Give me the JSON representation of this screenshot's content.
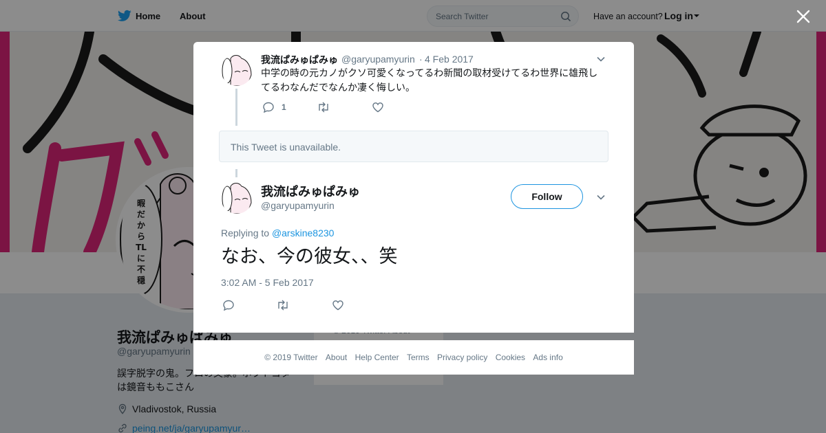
{
  "nav": {
    "home_label": "Home",
    "about_label": "About",
    "search_placeholder": "Search Twitter",
    "have_account": "Have an account?",
    "login_label": "Log in"
  },
  "profile": {
    "name": "我流ぱみゅぱみゅ",
    "handle": "@garyupamyurin",
    "bio": "誤字脱字の鬼。フロの文豪。ボクトヨタは鏡音ももこさん",
    "location": "Vladivostok, Russia",
    "link": "peing.net/ja/garyupamyur…",
    "avatar_caption": "暇だからツイートでもTLに不穏流すか"
  },
  "background_footer": "© 2019 Twitter  About",
  "modal": {
    "tweet1": {
      "name": "我流ぱみゅぱみゅ",
      "handle": "@garyupamyurin",
      "separator": "·",
      "date": "4 Feb 2017",
      "text": "中学の時の元カノがクソ可愛くなってるわ新聞の取材受けてるわ世界に雄飛してるわなんだでなんか凄く悔しい。",
      "reply_count": "1"
    },
    "unavailable_text": "This Tweet is unavailable.",
    "tweet2": {
      "name": "我流ぱみゅぱみゅ",
      "handle": "@garyupamyurin",
      "follow_label": "Follow",
      "replying_prefix": "Replying to",
      "replying_to": "@arskine8230",
      "text": "なお、今の彼女、、笑",
      "timestamp": "3:02 AM - 5 Feb 2017"
    }
  },
  "footer": {
    "copyright": "© 2019 Twitter",
    "links": [
      "About",
      "Help Center",
      "Terms",
      "Privacy policy",
      "Cookies",
      "Ads info"
    ]
  },
  "colors": {
    "twitter_blue": "#1da1f2",
    "link_blue": "#1b95e0",
    "banner_pink": "#e0267a",
    "secondary_text": "#657786"
  },
  "icons": {
    "brand": "twitter-bird-icon",
    "search": "search-icon",
    "close": "close-icon",
    "reply": "reply-icon",
    "retweet": "retweet-icon",
    "like": "heart-icon",
    "caret": "chevron-down-icon",
    "location": "location-pin-icon",
    "link": "link-icon"
  }
}
